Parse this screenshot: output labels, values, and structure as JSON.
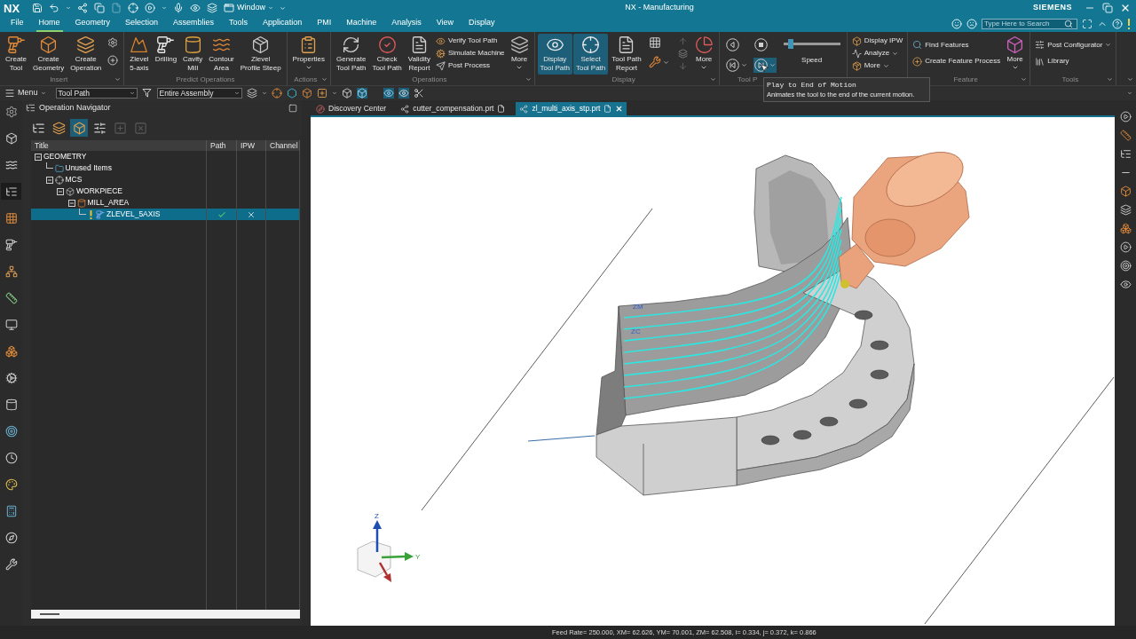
{
  "title_bar": {
    "app": "NX",
    "window_menu": "Window",
    "title": "NX - Manufacturing",
    "brand": "SIEMENS"
  },
  "menu_tabs": [
    {
      "label": "File",
      "selected": false
    },
    {
      "label": "Home",
      "selected": true
    },
    {
      "label": "Geometry",
      "selected": false
    },
    {
      "label": "Selection",
      "selected": false
    },
    {
      "label": "Assemblies",
      "selected": false
    },
    {
      "label": "Tools",
      "selected": false
    },
    {
      "label": "Application",
      "selected": false
    },
    {
      "label": "PMI",
      "selected": false
    },
    {
      "label": "Machine",
      "selected": false
    },
    {
      "label": "Analysis",
      "selected": false
    },
    {
      "label": "View",
      "selected": false
    },
    {
      "label": "Display",
      "selected": false
    }
  ],
  "search": {
    "placeholder": "Type Here to Search"
  },
  "ribbon": [
    {
      "label": "Insert",
      "launcher": true,
      "items": [
        {
          "kind": "large",
          "lines": [
            "Create",
            "Tool"
          ],
          "selected": false
        },
        {
          "kind": "large",
          "lines": [
            "Create",
            "Geometry"
          ],
          "selected": false
        },
        {
          "kind": "large",
          "lines": [
            "Create",
            "Operation"
          ],
          "selected": false
        },
        {
          "kind": "icons"
        }
      ]
    },
    {
      "label": "Predict Operations",
      "items": [
        {
          "kind": "large",
          "lines": [
            "Zlevel",
            "5-axis"
          ],
          "selected": false
        },
        {
          "kind": "large",
          "lines": [
            "Drilling"
          ],
          "selected": false
        },
        {
          "kind": "large",
          "lines": [
            "Cavity",
            "Mill"
          ],
          "selected": false
        },
        {
          "kind": "large",
          "lines": [
            "Contour",
            "Area"
          ],
          "selected": false
        },
        {
          "kind": "large",
          "lines": [
            "Zlevel",
            "Profile Steep"
          ],
          "selected": false
        }
      ]
    },
    {
      "label": "Actions",
      "launcher": true,
      "items": [
        {
          "kind": "large",
          "lines": [
            "Properties"
          ],
          "selected": false,
          "dropdown": true
        }
      ]
    },
    {
      "label": "Operations",
      "launcher": true,
      "items": [
        {
          "kind": "large",
          "lines": [
            "Generate",
            "Tool Path"
          ],
          "selected": false
        },
        {
          "kind": "large",
          "lines": [
            "Check",
            "Tool Path"
          ],
          "selected": false
        },
        {
          "kind": "large",
          "lines": [
            "Validity",
            "Report"
          ],
          "selected": false
        },
        {
          "kind": "stack",
          "items": [
            {
              "label": "Verify Tool Path"
            },
            {
              "label": "Simulate Machine"
            },
            {
              "label": "Post Process"
            }
          ]
        },
        {
          "kind": "large",
          "lines": [
            "More"
          ],
          "selected": false,
          "dropdown": true
        }
      ]
    },
    {
      "label": "Display",
      "launcher": true,
      "items": [
        {
          "kind": "large",
          "lines": [
            "Display",
            "Tool Path"
          ],
          "selected": true
        },
        {
          "kind": "large",
          "lines": [
            "Select",
            "Tool Path"
          ],
          "selected": true
        },
        {
          "kind": "large",
          "lines": [
            "Tool Path",
            "Report"
          ],
          "selected": false
        },
        {
          "kind": "icons"
        },
        {
          "kind": "large",
          "lines": [
            "More"
          ],
          "selected": false,
          "dropdown": true
        }
      ]
    },
    {
      "label": "Tool P",
      "items": [
        {
          "kind": "playback",
          "buttons": [
            {
              "selected": false
            },
            {
              "selected": false
            },
            {
              "selected": false,
              "dropdown": true
            },
            {
              "selected": true,
              "dropdown": true
            }
          ]
        },
        {
          "kind": "slider",
          "label": "Speed",
          "level": 0.1
        }
      ]
    },
    {
      "items": [
        {
          "kind": "stack",
          "items": [
            {
              "label": "Display IPW"
            },
            {
              "label": "Analyze",
              "dropdown": true
            },
            {
              "label": "More",
              "dropdown": true
            }
          ]
        }
      ]
    },
    {
      "label": "Feature",
      "launcher": true,
      "items": [
        {
          "kind": "stack",
          "items": [
            {
              "label": "Find Features"
            },
            {
              "label": "Create Feature Process"
            }
          ]
        },
        {
          "kind": "large",
          "lines": [
            "More"
          ],
          "selected": false,
          "dropdown": true
        }
      ]
    },
    {
      "label": "Tools",
      "launcher": true,
      "items": [
        {
          "kind": "stack",
          "items": [
            {
              "label": "Post Configurator",
              "dropdown": true
            },
            {
              "label": "Library"
            }
          ]
        }
      ]
    }
  ],
  "tooltip": {
    "title": "Play to End of Motion",
    "description": "Animates the tool to the end of the current motion."
  },
  "toolbar": {
    "menu": "Menu",
    "selection_filter": "Tool Path",
    "scope": "Entire Assembly"
  },
  "resource_bar": [
    {
      "selected": false
    },
    {
      "selected": false
    },
    {
      "selected": false
    },
    {
      "selected": true
    },
    {
      "selected": false
    },
    {
      "selected": false
    },
    {
      "selected": false
    },
    {
      "selected": false
    },
    {
      "selected": false
    },
    {
      "selected": false
    },
    {
      "selected": false
    },
    {
      "selected": false
    },
    {
      "selected": false
    },
    {
      "selected": false
    },
    {
      "selected": false
    },
    {
      "selected": false
    },
    {
      "selected": false
    },
    {
      "selected": false
    }
  ],
  "navigator": {
    "title": "Operation Navigator",
    "tools": [
      {
        "selected": false,
        "disabled": false
      },
      {
        "selected": false,
        "disabled": false
      },
      {
        "selected": true,
        "disabled": false
      },
      {
        "selected": false,
        "disabled": false
      },
      {
        "selected": false,
        "disabled": true
      },
      {
        "selected": false,
        "disabled": true
      }
    ],
    "columns": [
      "Title",
      "Path",
      "IPW",
      "Channel"
    ],
    "tree": [
      {
        "label": "GEOMETRY",
        "expanded": true,
        "selected": false,
        "children": [
          {
            "label": "Unused Items",
            "kind": "folder",
            "selected": false
          },
          {
            "label": "MCS",
            "kind": "csys",
            "expanded": true,
            "selected": false,
            "children": [
              {
                "label": "WORKPIECE",
                "kind": "workpiece",
                "expanded": true,
                "selected": false,
                "children": [
                  {
                    "label": "MILL_AREA",
                    "kind": "area",
                    "expanded": true,
                    "selected": false,
                    "children": [
                      {
                        "label": "ZLEVEL_5AXIS",
                        "kind": "operation",
                        "selected": true,
                        "warning": true,
                        "path_ok": true,
                        "ipw_missing": true
                      }
                    ]
                  }
                ]
              }
            ]
          }
        ]
      }
    ]
  },
  "document_tabs": [
    {
      "label": "Discovery Center",
      "kind": "home",
      "selected": false
    },
    {
      "label": "cutter_compensation.prt",
      "kind": "part",
      "selected": false
    },
    {
      "label": "zl_multi_axis_stp.prt",
      "kind": "part",
      "selected": true
    }
  ],
  "viewport": {
    "csys_labels": [
      "ZM",
      "ZC"
    ],
    "triad_labels": [
      "Z",
      "Y"
    ]
  },
  "status_bar": "Feed Rate= 250.000, XM= 62.626, YM= 70.001, ZM= 62.508, i= 0.334, j= 0.372, k= 0.866"
}
